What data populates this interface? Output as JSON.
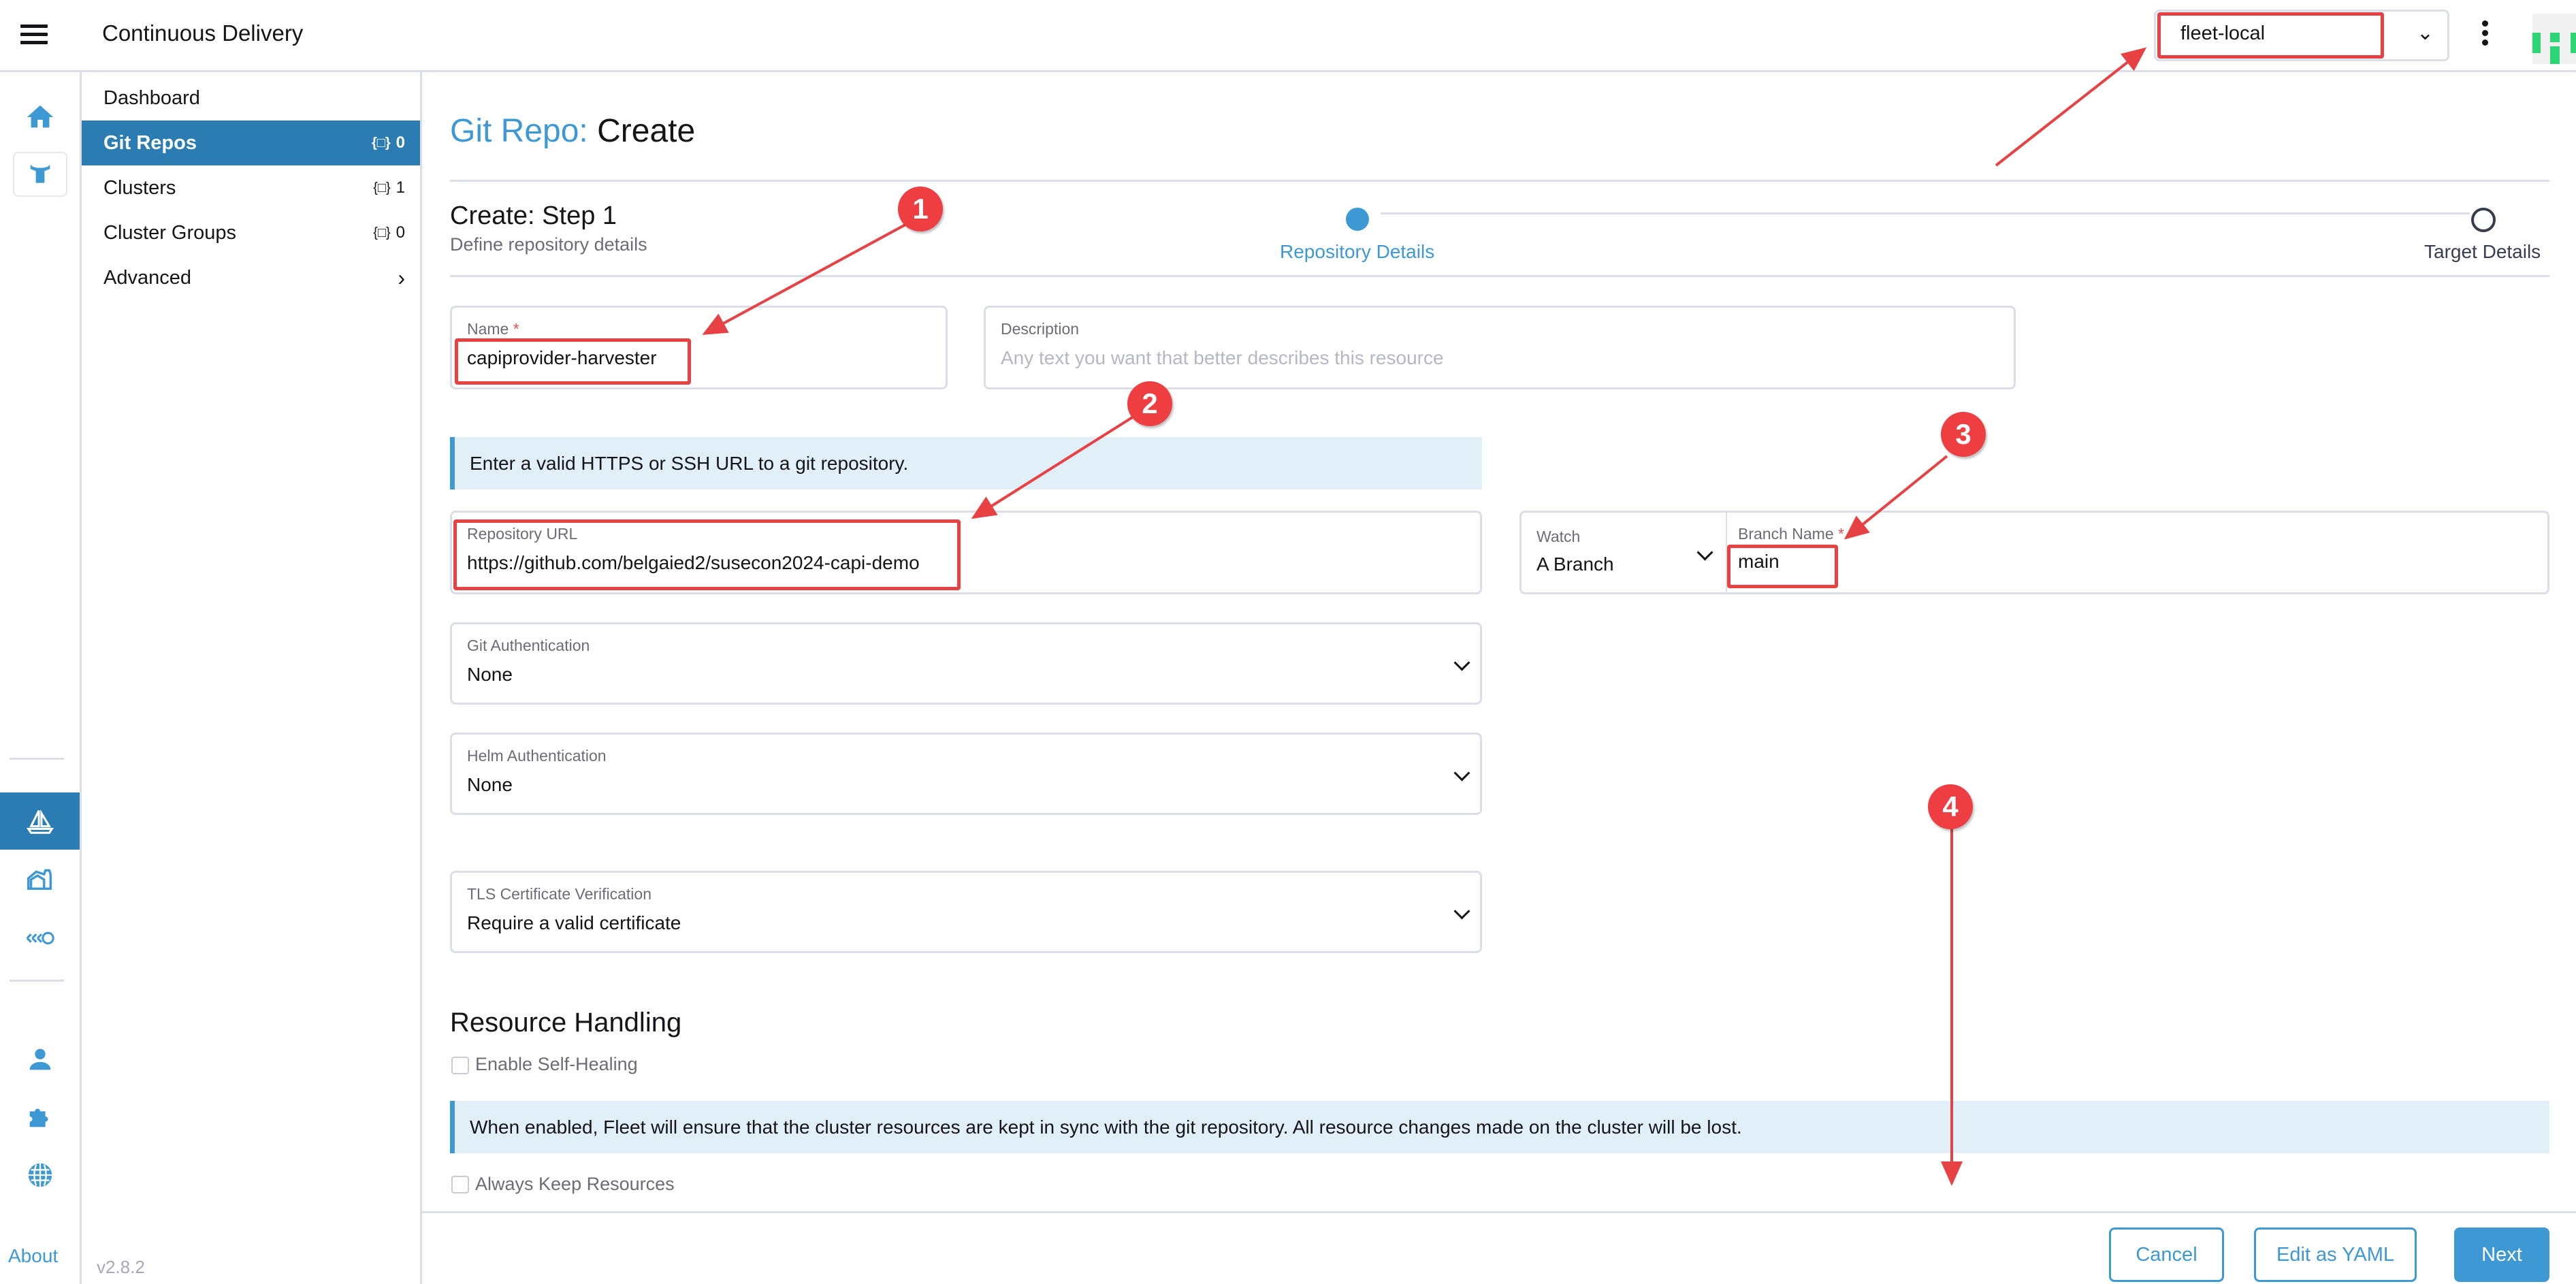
{
  "header": {
    "app_title": "Continuous Delivery",
    "workspace_select": {
      "value": "fleet-local"
    }
  },
  "rail": {
    "icons": [
      "home-icon",
      "rancher-logo-icon",
      "fleet-sailboat-icon",
      "harvester-barn-icon",
      "kubewarden-icon",
      "user-icon",
      "extensions-puzzle-icon",
      "globe-icon"
    ],
    "about_label": "About"
  },
  "sidenav": {
    "items": [
      {
        "label": "Dashboard"
      },
      {
        "label": "Git Repos",
        "count": "0",
        "active": true
      },
      {
        "label": "Clusters",
        "count": "1"
      },
      {
        "label": "Cluster Groups",
        "count": "0"
      },
      {
        "label": "Advanced",
        "expandable": true
      }
    ],
    "version": "v2.8.2"
  },
  "page": {
    "title_prefix": "Git Repo:",
    "title_action": "Create",
    "step_title": "Create: Step 1",
    "step_subtitle": "Define repository details",
    "steps": [
      {
        "label": "Repository Details",
        "active": true
      },
      {
        "label": "Target Details",
        "active": false
      }
    ]
  },
  "form": {
    "name": {
      "label": "Name",
      "required": "*",
      "value": "capiprovider-harvester"
    },
    "description": {
      "label": "Description",
      "placeholder": "Any text you want that better describes this resource"
    },
    "url_hint": "Enter a valid HTTPS or SSH URL to a git repository.",
    "repo_url": {
      "label": "Repository URL",
      "value": "https://github.com/belgaied2/susecon2024-capi-demo"
    },
    "watch": {
      "label": "Watch",
      "value": "A Branch"
    },
    "branch": {
      "label": "Branch Name",
      "required": "*",
      "value": "main"
    },
    "git_auth": {
      "label": "Git Authentication",
      "value": "None"
    },
    "helm_auth": {
      "label": "Helm Authentication",
      "value": "None"
    },
    "tls": {
      "label": "TLS Certificate Verification",
      "value": "Require a valid certificate"
    },
    "resource_handling": {
      "heading": "Resource Handling",
      "self_healing": {
        "label": "Enable Self-Healing",
        "checked": false
      },
      "self_healing_info": "When enabled, Fleet will ensure that the cluster resources are kept in sync with the git repository. All resource changes made on the cluster will be lost.",
      "keep_resources": {
        "label": "Always Keep Resources",
        "checked": false
      }
    }
  },
  "footer": {
    "cancel_label": "Cancel",
    "yaml_label": "Edit as YAML",
    "next_label": "Next"
  },
  "annotations": {
    "markers": [
      "1",
      "2",
      "3",
      "4"
    ],
    "color": "#ef3e42"
  }
}
